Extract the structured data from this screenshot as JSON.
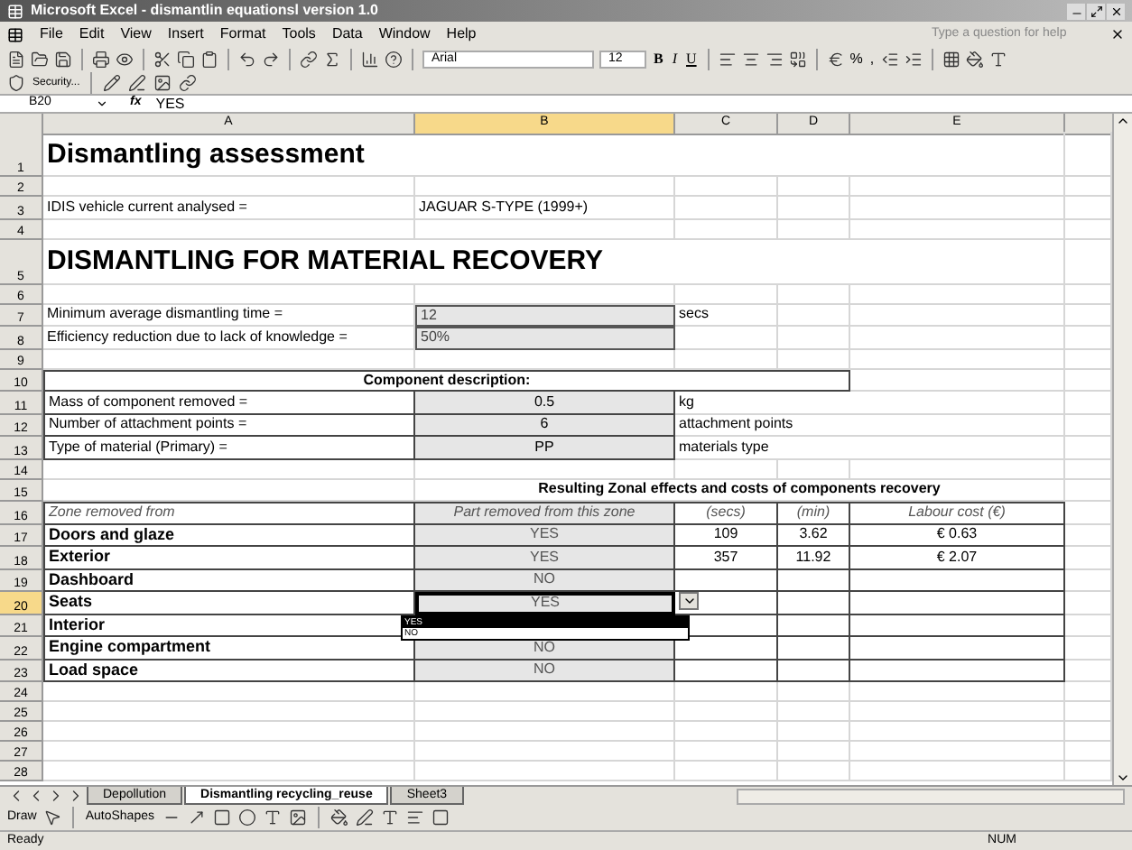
{
  "window": {
    "title": "Microsoft Excel - dismantlin equationsl version 1.0"
  },
  "menu": [
    "File",
    "Edit",
    "View",
    "Insert",
    "Format",
    "Tools",
    "Data",
    "Window",
    "Help"
  ],
  "help_box": {
    "placeholder": "Type a question for help"
  },
  "toolbar": {
    "font": "Arial",
    "size": "12",
    "bold": "B",
    "italic": "I",
    "underline": "U",
    "percent": "%",
    "comma": ","
  },
  "toolbar2": {
    "security": "Security..."
  },
  "formula_bar": {
    "name_box": "B20",
    "fx": "fx",
    "formula": "YES"
  },
  "columns": [
    {
      "label": "A",
      "selected": false
    },
    {
      "label": "B",
      "selected": true
    },
    {
      "label": "C",
      "selected": false
    },
    {
      "label": "D",
      "selected": false
    },
    {
      "label": "E",
      "selected": false
    }
  ],
  "rows": [
    {
      "number": "1",
      "kind": "heading",
      "a": "Dismantling assessment",
      "selected": false
    },
    {
      "number": "2",
      "kind": "blank",
      "selected": false
    },
    {
      "number": "3",
      "kind": "info",
      "a": "IDIS vehicle current analysed =",
      "b": "JAGUAR S-TYPE (1999+)",
      "selected": false
    },
    {
      "number": "4",
      "kind": "blank",
      "selected": false
    },
    {
      "number": "5",
      "kind": "heading",
      "a": "DISMANTLING FOR MATERIAL RECOVERY",
      "selected": false
    },
    {
      "number": "6",
      "kind": "blank",
      "selected": false
    },
    {
      "number": "7",
      "kind": "input",
      "a": "Minimum average dismantling time =",
      "b": "12",
      "c": "secs",
      "selected": false
    },
    {
      "number": "8",
      "kind": "input",
      "a": "Efficiency reduction due to lack of knowledge =",
      "b": "50%",
      "selected": false
    },
    {
      "number": "9",
      "kind": "blank",
      "selected": false
    },
    {
      "number": "10",
      "kind": "section",
      "a": "Component description:",
      "selected": false
    },
    {
      "number": "11",
      "kind": "param",
      "a": "Mass of component removed =",
      "b": "0.5",
      "c": "kg",
      "selected": false
    },
    {
      "number": "12",
      "kind": "param",
      "a": "Number of attachment points =",
      "b": "6",
      "c": "attachment points",
      "selected": false
    },
    {
      "number": "13",
      "kind": "param",
      "a": "Type of material (Primary) =",
      "b": "PP",
      "c": "materials type",
      "selected": false
    },
    {
      "number": "14",
      "kind": "blank",
      "selected": false
    },
    {
      "number": "15",
      "kind": "table_title",
      "b": "Resulting Zonal effects and costs of components recovery",
      "selected": false
    },
    {
      "number": "16",
      "kind": "table_header",
      "a": "Zone removed from",
      "b": "Part removed from this zone",
      "c": "(secs)",
      "d": "(min)",
      "e": "Labour cost (€)",
      "selected": false
    },
    {
      "number": "17",
      "kind": "zone",
      "a": "Doors and glaze",
      "b": "YES",
      "c": "109",
      "d": "3.62",
      "e": "€ 0.63",
      "selected": false
    },
    {
      "number": "18",
      "kind": "zone",
      "a": "Exterior",
      "b": "YES",
      "c": "357",
      "d": "11.92",
      "e": "€ 2.07",
      "selected": false
    },
    {
      "number": "19",
      "kind": "zone",
      "a": "Dashboard",
      "b": "NO",
      "selected": false
    },
    {
      "number": "20",
      "kind": "zone",
      "a": "Seats",
      "b": "YES",
      "selected": true
    },
    {
      "number": "21",
      "kind": "zone",
      "a": "Interior",
      "selected": false
    },
    {
      "number": "22",
      "kind": "zone",
      "a": "Engine compartment",
      "b": "NO",
      "selected": false
    },
    {
      "number": "23",
      "kind": "zone",
      "a": "Load space",
      "b": "NO",
      "selected": false
    },
    {
      "number": "24",
      "kind": "blank",
      "selected": false
    },
    {
      "number": "25",
      "kind": "blank",
      "selected": false
    },
    {
      "number": "26",
      "kind": "blank",
      "selected": false
    },
    {
      "number": "27",
      "kind": "blank",
      "selected": false
    },
    {
      "number": "28",
      "kind": "blank",
      "selected": false
    }
  ],
  "dropdown": [
    {
      "label": "YES",
      "selected": true
    },
    {
      "label": "NO",
      "selected": false
    }
  ],
  "sheet_tabs": [
    {
      "label": "Depollution",
      "selected": false
    },
    {
      "label": "Dismantling recycling_reuse",
      "selected": true
    },
    {
      "label": "Sheet3",
      "selected": false
    }
  ],
  "draw_toolbar": {
    "draw": "Draw",
    "autoshapes": "AutoShapes"
  },
  "status_bar": {
    "text": "Ready",
    "num": "NUM"
  }
}
